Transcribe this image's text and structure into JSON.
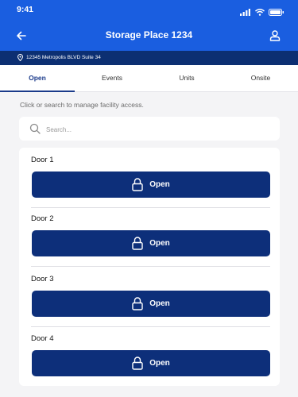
{
  "status": {
    "time": "9:41"
  },
  "header": {
    "title": "Storage Place 1234"
  },
  "address": "12345 Metropolis BLVD Suite 34",
  "tabs": [
    {
      "label": "Open",
      "active": true
    },
    {
      "label": "Events",
      "active": false
    },
    {
      "label": "Units",
      "active": false
    },
    {
      "label": "Onsite",
      "active": false
    }
  ],
  "hint": "Click or search to manage facility access.",
  "search": {
    "placeholder": "Search...",
    "value": ""
  },
  "doors": [
    {
      "name": "Door 1",
      "button_label": "Open"
    },
    {
      "name": "Door 2",
      "button_label": "Open"
    },
    {
      "name": "Door 3",
      "button_label": "Open"
    },
    {
      "name": "Door 4",
      "button_label": "Open"
    }
  ],
  "icons": {
    "back": "arrow-left-icon",
    "profile": "person-icon",
    "location": "location-pin-icon",
    "search": "search-icon",
    "lock": "lock-icon"
  },
  "colors": {
    "header_blue": "#1a5ee0",
    "address_navy": "#0c2f72",
    "button_navy": "#0d2f7a",
    "background": "#f4f4f6"
  }
}
